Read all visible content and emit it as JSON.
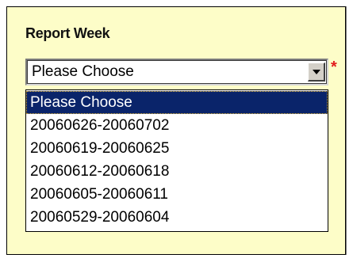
{
  "form": {
    "field_label": "Report Week",
    "select": {
      "value": "Please Choose",
      "required_mark": "*"
    },
    "options": [
      {
        "label": "Please Choose",
        "selected": true
      },
      {
        "label": "20060626-20060702",
        "selected": false
      },
      {
        "label": "20060619-20060625",
        "selected": false
      },
      {
        "label": "20060612-20060618",
        "selected": false
      },
      {
        "label": "20060605-20060611",
        "selected": false
      },
      {
        "label": "20060529-20060604",
        "selected": false
      }
    ]
  },
  "colors": {
    "panel_background": "#fdfdc8",
    "highlight": "#0a246a",
    "required": "#e21d1d"
  },
  "icons": {
    "dropdown": "chevron-down-icon"
  }
}
